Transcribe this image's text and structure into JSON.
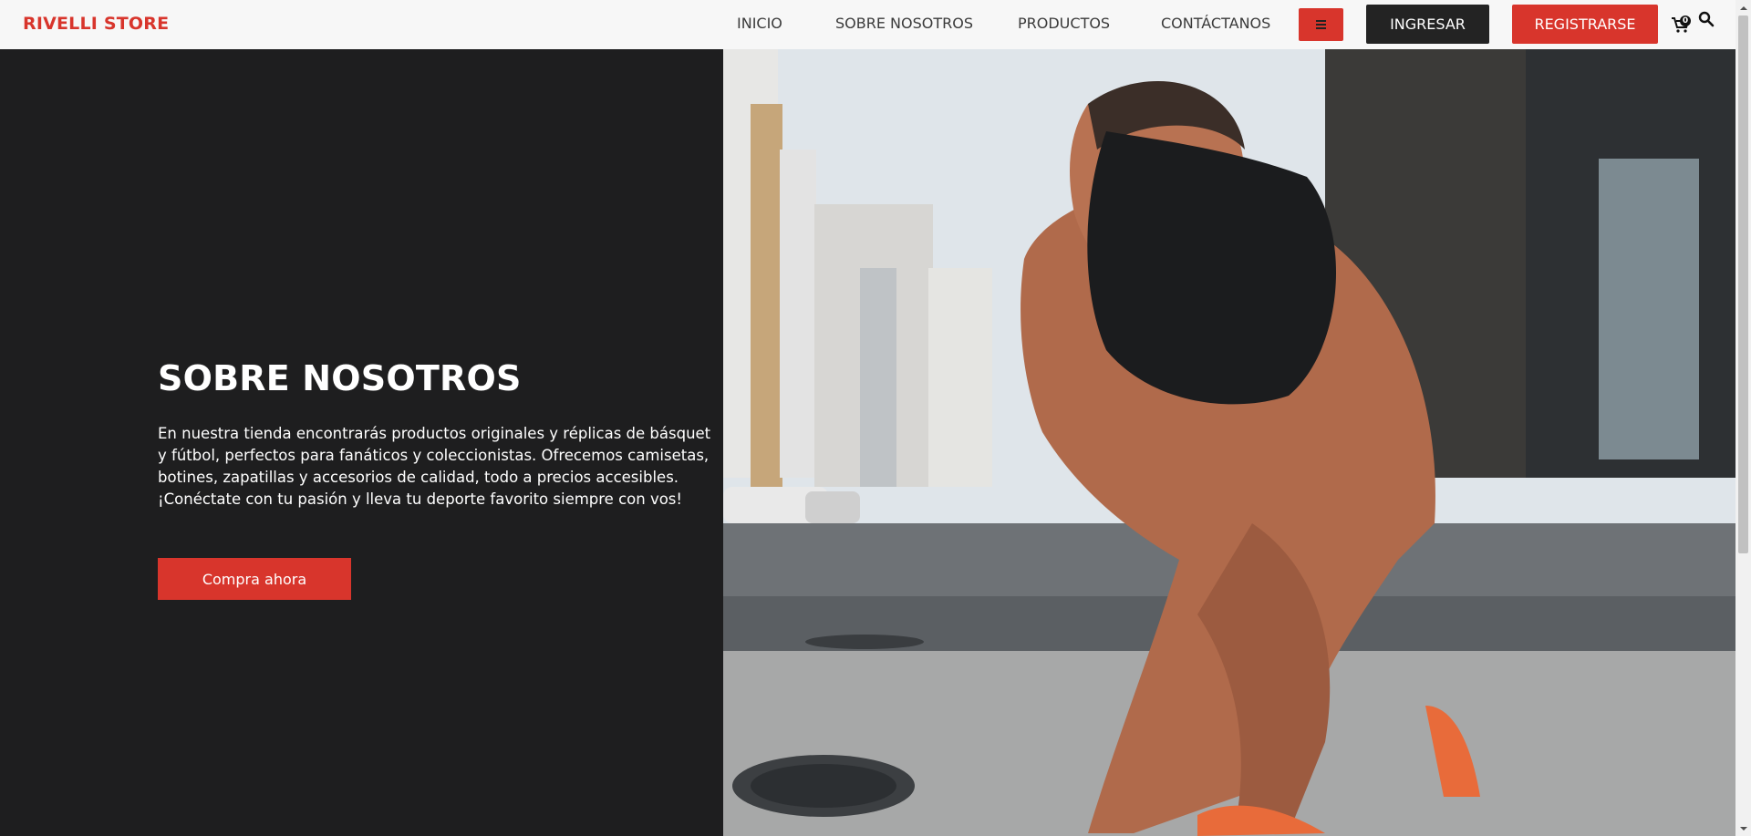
{
  "header": {
    "logo": "RIVELLI STORE",
    "nav": [
      {
        "label": "INICIO"
      },
      {
        "label": "SOBRE NOSOTROS"
      },
      {
        "label": "PRODUCTOS"
      },
      {
        "label": "CONTÁCTANOS"
      }
    ],
    "menu_icon": "hamburger-icon",
    "login_label": "INGRESAR",
    "register_label": "REGISTRARSE",
    "cart_icon": "cart-icon",
    "cart_count": "0",
    "search_icon": "search-icon"
  },
  "hero": {
    "title": "SOBRE NOSOTROS",
    "text": "En nuestra tienda encontrarás productos originales y réplicas de básquet y fútbol, perfectos para fanáticos y coleccionistas. Ofrecemos camisetas, botines, zapatillas y accesorios de calidad, todo a precios accesibles. ¡Conéctate con tu pasión y lleva tu deporte favorito siempre con vos!",
    "cta_label": "Compra ahora"
  },
  "colors": {
    "accent": "#d8352c",
    "dark": "#1e1e1f",
    "header_bg": "#f7f7f7"
  }
}
